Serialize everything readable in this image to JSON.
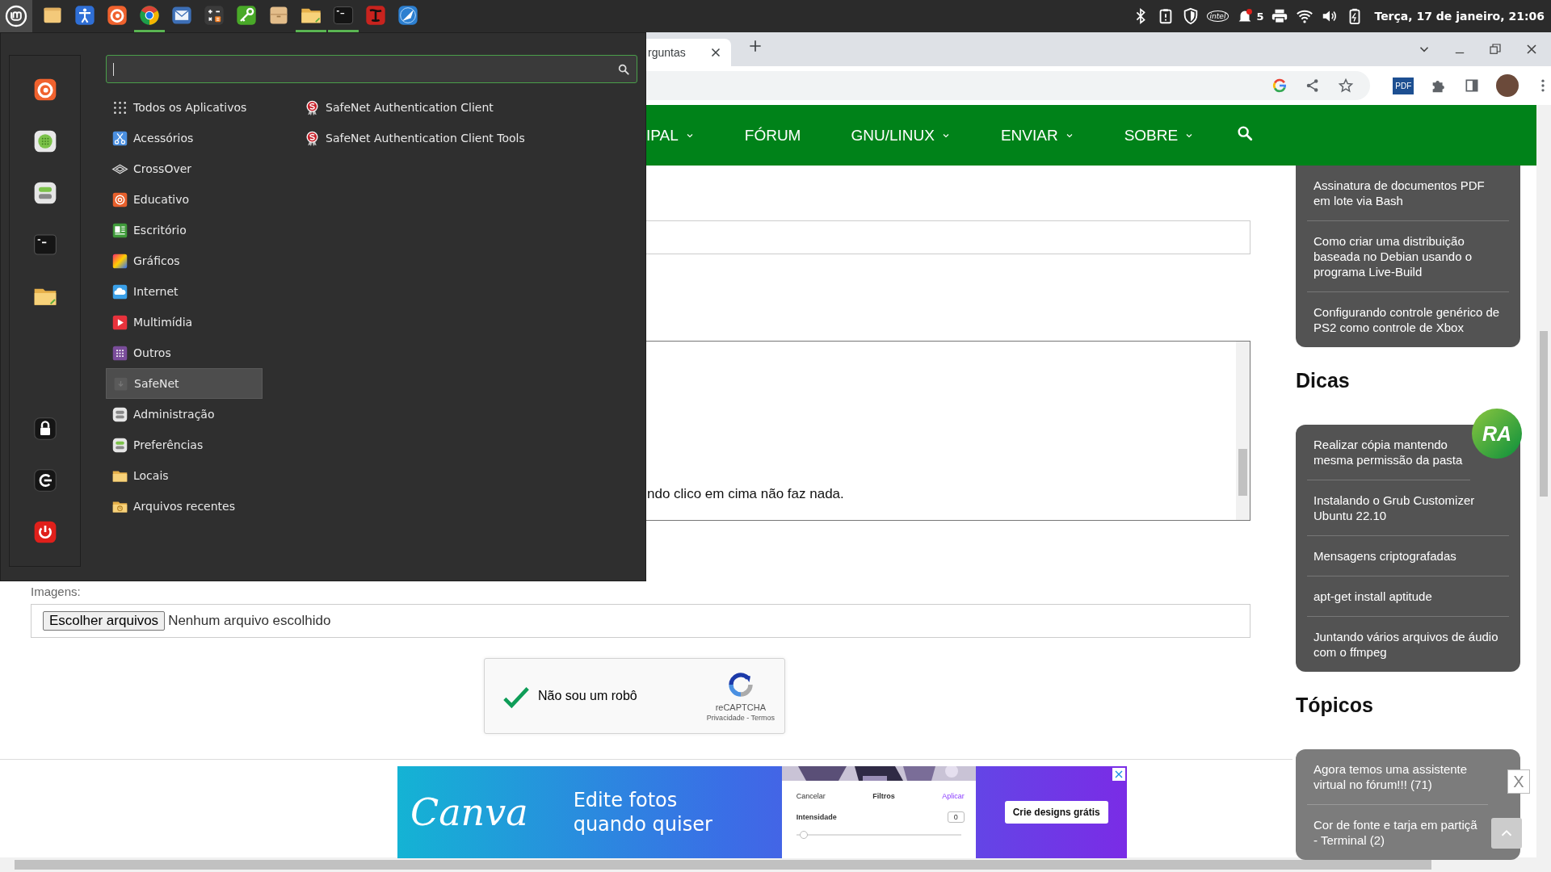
{
  "panel": {
    "launchers": [
      {
        "kind": "notebook",
        "active": false
      },
      {
        "kind": "accessibility",
        "active": false
      },
      {
        "kind": "swirl",
        "active": false
      },
      {
        "kind": "chrome",
        "active": true
      },
      {
        "kind": "mail",
        "active": false
      },
      {
        "kind": "calculator",
        "active": false
      },
      {
        "kind": "key",
        "active": false
      },
      {
        "kind": "drawer",
        "active": false
      },
      {
        "kind": "files",
        "active": true
      },
      {
        "kind": "terminal",
        "active": true
      },
      {
        "kind": "font",
        "active": false
      },
      {
        "kind": "compass",
        "active": false
      }
    ],
    "tray": [
      {
        "kind": "bluetooth"
      },
      {
        "kind": "clipboard"
      },
      {
        "kind": "shield"
      },
      {
        "kind": "chip",
        "label": "intel"
      },
      {
        "kind": "bell",
        "count": "5"
      },
      {
        "kind": "printer"
      },
      {
        "kind": "wifi"
      },
      {
        "kind": "volume"
      },
      {
        "kind": "battery"
      }
    ],
    "clock": "Terça, 17 de janeiro, 21:06"
  },
  "browser": {
    "tab": {
      "title": "rguntas"
    },
    "pdf_label": "PDF"
  },
  "nav": [
    {
      "label": "IPAL",
      "dropdown": true
    },
    {
      "label": "FÓRUM",
      "dropdown": false
    },
    {
      "label": "GNU/LINUX",
      "dropdown": true
    },
    {
      "label": "ENVIAR",
      "dropdown": true
    },
    {
      "label": "SOBRE",
      "dropdown": true
    }
  ],
  "form": {
    "message_text": "ndo clico em cima não faz nada.",
    "images_label": "Imagens:",
    "file_button": "Escolher arquivos",
    "file_status": "Nenhum arquivo escolhido",
    "captcha": {
      "label": "Não sou um robô",
      "checked": true,
      "brand": "reCAPTCHA",
      "links": "Privacidade - Termos"
    }
  },
  "sidebar": {
    "top_items": [
      "Assinatura de documentos PDF em lote via Bash",
      "Como criar uma distribuição baseada no Debian usando o programa Live-Build",
      "Configurando controle genérico de PS2 como controle de Xbox"
    ],
    "badge": "RA",
    "sections": [
      {
        "title": "Dicas",
        "items": [
          "Realizar cópia mantendo mesma permissão da pasta",
          "Instalando o Grub Customizer Ubuntu 22.10",
          "Mensagens criptografadas",
          "apt-get install aptitude",
          "Juntando vários arquivos de áudio com o ffmpeg"
        ]
      },
      {
        "title": "Tópicos",
        "dimmed": true,
        "items": [
          "Agora temos uma assistente virtual no fórum!!! (71)",
          "Cor de fonte e tarja em partiçã - Terminal (2)"
        ]
      }
    ]
  },
  "ad": {
    "logo": "Canva",
    "headline": "Edite fotos quando quiser",
    "mock": {
      "cancel": "Cancelar",
      "title": "Filtros",
      "apply": "Aplicar",
      "setting": "Intensidade",
      "value": "0",
      "level": 0.02
    },
    "cta": "Crie designs grátis",
    "close": "X"
  },
  "menu": {
    "favorites": [
      {
        "kind": "swirl"
      },
      {
        "kind": "dots"
      },
      {
        "kind": "prefs"
      },
      {
        "kind": "terminal"
      },
      {
        "kind": "files"
      }
    ],
    "session": [
      {
        "kind": "lock"
      },
      {
        "kind": "logout"
      },
      {
        "kind": "power"
      }
    ],
    "categories": [
      {
        "label": "Todos os Aplicativos",
        "kind": "all",
        "selected": false
      },
      {
        "label": "Acessórios",
        "kind": "scissors",
        "selected": false
      },
      {
        "label": "CrossOver",
        "kind": "crossover",
        "selected": false
      },
      {
        "label": "Educativo",
        "kind": "edu",
        "selected": false
      },
      {
        "label": "Escritório",
        "kind": "office",
        "selected": false
      },
      {
        "label": "Gráficos",
        "kind": "graphics",
        "selected": false
      },
      {
        "label": "Internet",
        "kind": "internet",
        "selected": false
      },
      {
        "label": "Multimídia",
        "kind": "media",
        "selected": false
      },
      {
        "label": "Outros",
        "kind": "others",
        "selected": false
      },
      {
        "label": "SafeNet",
        "kind": "safenet",
        "selected": true
      },
      {
        "label": "Administração",
        "kind": "admin",
        "selected": false
      },
      {
        "label": "Preferências",
        "kind": "prefs",
        "selected": false
      },
      {
        "label": "Locais",
        "kind": "places",
        "selected": false
      },
      {
        "label": "Arquivos recentes",
        "kind": "recent",
        "selected": false
      }
    ],
    "apps": [
      {
        "label": "SafeNet Authentication Client"
      },
      {
        "label": "SafeNet Authentication Client Tools"
      }
    ]
  }
}
